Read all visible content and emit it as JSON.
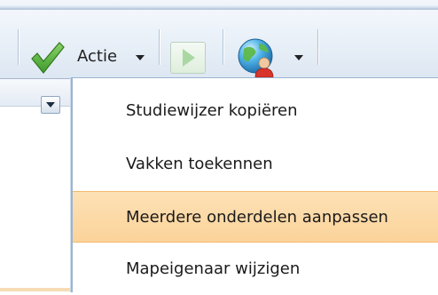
{
  "toolbar": {
    "actie_label": "Actie",
    "icons": [
      "check-icon",
      "play-icon",
      "globe-user-icon"
    ]
  },
  "menu": {
    "items": [
      {
        "label": "Studiewijzer kopiëren",
        "highlighted": false
      },
      {
        "label": "Vakken toekennen",
        "highlighted": false
      },
      {
        "label": "Meerdere onderdelen aanpassen",
        "highlighted": true
      },
      {
        "label": "Mapeigenaar wijzigen",
        "highlighted": false
      }
    ]
  },
  "colors": {
    "highlight": "#fbd39a",
    "toolbar_bg": "#e9f0f8",
    "menu_border": "#9ab4d2"
  }
}
